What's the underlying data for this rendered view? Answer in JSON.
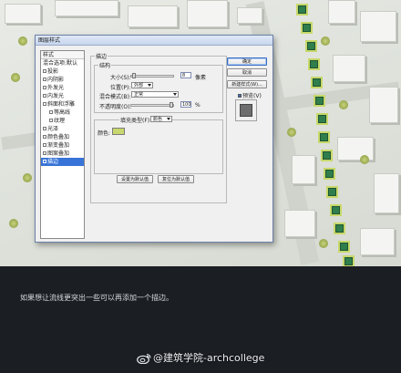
{
  "dialog": {
    "title": "图层样式",
    "style_list": {
      "header": "样式",
      "items": [
        {
          "label": "混合选项:默认",
          "checkbox": false,
          "selected": false
        },
        {
          "label": "投影",
          "checkbox": true,
          "selected": false
        },
        {
          "label": "内阴影",
          "checkbox": true,
          "selected": false
        },
        {
          "label": "外发光",
          "checkbox": true,
          "selected": false
        },
        {
          "label": "内发光",
          "checkbox": true,
          "selected": false
        },
        {
          "label": "斜面和浮雕",
          "checkbox": true,
          "selected": false
        },
        {
          "label": "等高线",
          "checkbox": true,
          "selected": false,
          "sub": true
        },
        {
          "label": "纹理",
          "checkbox": true,
          "selected": false,
          "sub": true
        },
        {
          "label": "光泽",
          "checkbox": true,
          "selected": false
        },
        {
          "label": "颜色叠加",
          "checkbox": true,
          "selected": false
        },
        {
          "label": "渐变叠加",
          "checkbox": true,
          "selected": false
        },
        {
          "label": "图案叠加",
          "checkbox": true,
          "selected": false
        },
        {
          "label": "描边",
          "checkbox": true,
          "selected": true
        }
      ]
    },
    "stroke": {
      "section_title": "描边",
      "structure_title": "结构",
      "size_label": "大小(S):",
      "size_value": "8",
      "size_unit": "像素",
      "position_label": "位置(P):",
      "position_value": "外部",
      "blend_label": "混合模式(B):",
      "blend_value": "正常",
      "opacity_label": "不透明度(O):",
      "opacity_value": "100",
      "opacity_unit": "%",
      "fill_type_label": "填充类型(F):",
      "fill_type_value": "颜色",
      "color_label": "颜色:",
      "color_hex": "#c9d86e",
      "set_default_button": "设置为默认值",
      "reset_default_button": "复位为默认值"
    },
    "buttons": {
      "ok": "确定",
      "cancel": "取消",
      "new_style": "新建样式(W)...",
      "preview_label": "预览(V)",
      "preview_checked": true
    }
  },
  "caption": {
    "text": "如果想让流线更突出一些可以再添加一个描边。"
  },
  "watermark": {
    "text": "@建筑学院-archcollege",
    "icon": "weibo-icon"
  }
}
